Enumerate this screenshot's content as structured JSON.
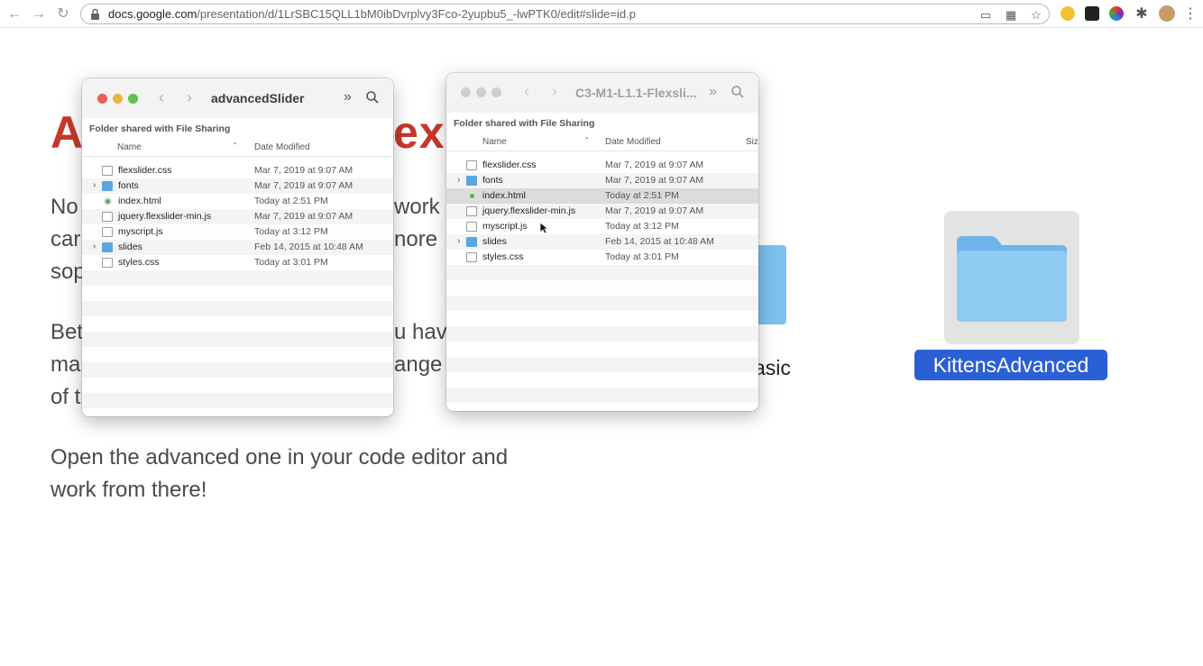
{
  "browser": {
    "url_host": "docs.google.com",
    "url_path": "/presentation/d/1LrSBC15QLL1bM0ibDvrplvy3Fco-2yupbu5_-lwPTK0/edit#slide=id.p",
    "icons": [
      "back-icon",
      "forward-icon",
      "reload-icon",
      "lock-icon",
      "cast-icon",
      "grid-icon",
      "star-icon",
      "puzzle-icon",
      "menu-icon"
    ]
  },
  "slide": {
    "title_visible": "A",
    "title_right_visible": "ex",
    "para1": {
      "line1_a": "No",
      "line1_b": "work",
      "line2_a": "car",
      "line2_b": "nore",
      "line3_a": "sop"
    },
    "para2": {
      "line1_a": "Bet",
      "line1_b": "u have",
      "line2_a": "ma",
      "line2_b": "ange",
      "line3_a": "of t"
    },
    "para3": {
      "line1": "Open the advanced one in your code editor and",
      "line2": "work from there!"
    },
    "basic_fragment": "asic"
  },
  "finder_left": {
    "title": "advancedSlider",
    "section": "Folder shared with File Sharing",
    "col_name": "Name",
    "col_date": "Date Modified",
    "rows": [
      {
        "name": "flexslider.css",
        "date": "Mar 7, 2019 at 9:07 AM",
        "kind": "doc"
      },
      {
        "name": "fonts",
        "date": "Mar 7, 2019 at 9:07 AM",
        "kind": "folder"
      },
      {
        "name": "index.html",
        "date": "Today at 2:51 PM",
        "kind": "html"
      },
      {
        "name": "jquery.flexslider-min.js",
        "date": "Mar 7, 2019 at 9:07 AM",
        "kind": "doc"
      },
      {
        "name": "myscript.js",
        "date": "Today at 3:12 PM",
        "kind": "js"
      },
      {
        "name": "slides",
        "date": "Feb 14, 2015 at 10:48 AM",
        "kind": "folder"
      },
      {
        "name": "styles.css",
        "date": "Today at 3:01 PM",
        "kind": "doc"
      }
    ]
  },
  "finder_right": {
    "title": "C3-M1-L1.1-Flexsli...",
    "section": "Folder shared with File Sharing",
    "col_name": "Name",
    "col_date": "Date Modified",
    "col_size": "Siz",
    "rows": [
      {
        "name": "flexslider.css",
        "date": "Mar 7, 2019 at 9:07 AM",
        "kind": "doc"
      },
      {
        "name": "fonts",
        "date": "Mar 7, 2019 at 9:07 AM",
        "kind": "folder"
      },
      {
        "name": "index.html",
        "date": "Today at 2:51 PM",
        "kind": "html"
      },
      {
        "name": "jquery.flexslider-min.js",
        "date": "Mar 7, 2019 at 9:07 AM",
        "kind": "doc"
      },
      {
        "name": "myscript.js",
        "date": "Today at 3:12 PM",
        "kind": "js"
      },
      {
        "name": "slides",
        "date": "Feb 14, 2015 at 10:48 AM",
        "kind": "folder"
      },
      {
        "name": "styles.css",
        "date": "Today at 3:01 PM",
        "kind": "doc"
      }
    ]
  },
  "desktop": {
    "folder_label": "KittensAdvanced"
  },
  "colors": {
    "title_red": "#c8372c",
    "folder_blue": "#7cc0ee",
    "selection_blue": "#2b5fd6"
  }
}
